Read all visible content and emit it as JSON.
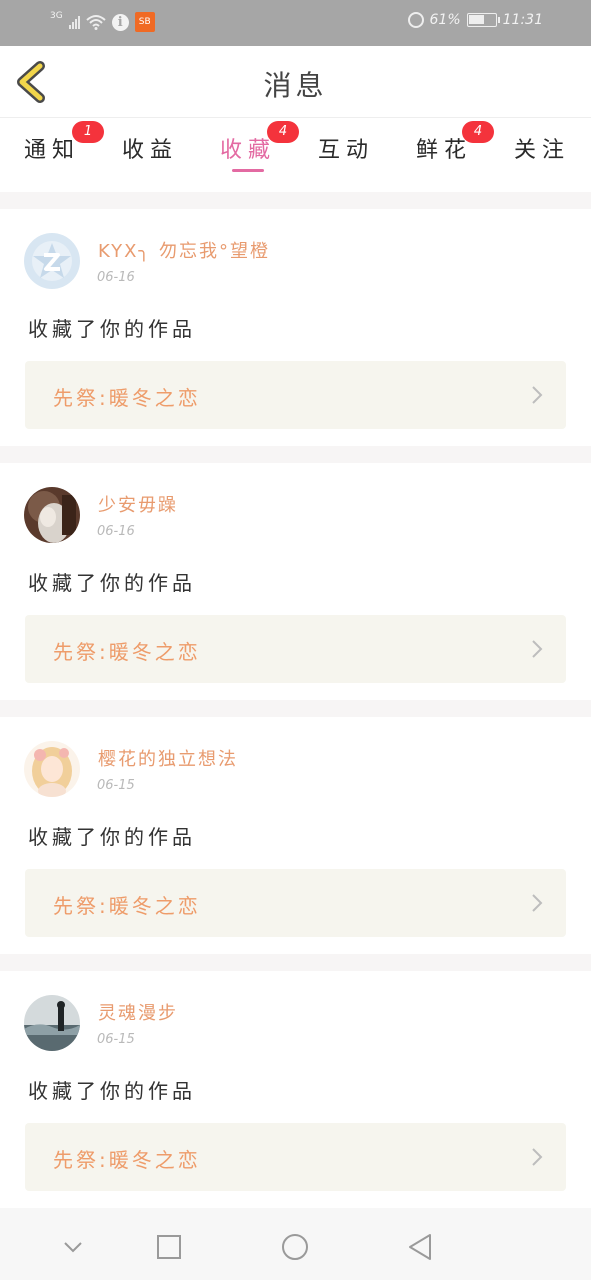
{
  "status_bar": {
    "network": "3G",
    "app_badge": "SB",
    "battery": "61%",
    "battery_level": 0.61,
    "time": "11:31"
  },
  "header": {
    "title": "消息",
    "back_icon": "chevron-left-icon"
  },
  "tabs": [
    {
      "label": "通知",
      "badge": "1",
      "active": false
    },
    {
      "label": "收益",
      "badge": "",
      "active": false
    },
    {
      "label": "收藏",
      "badge": "4",
      "active": true
    },
    {
      "label": "互动",
      "badge": "",
      "active": false
    },
    {
      "label": "鲜花",
      "badge": "4",
      "active": false
    },
    {
      "label": "关注",
      "badge": "",
      "active": false
    }
  ],
  "messages": [
    {
      "username": "KYX╮ 勿忘我°望橙",
      "date": "06-16",
      "action": "收藏了你的作品",
      "work_title": "先祭:暖冬之恋",
      "avatar": "default-qq-avatar"
    },
    {
      "username": "少安毋躁",
      "date": "06-16",
      "action": "收藏了你的作品",
      "work_title": "先祭:暖冬之恋",
      "avatar": "photo-avatar"
    },
    {
      "username": "樱花的独立想法",
      "date": "06-15",
      "action": "收藏了你的作品",
      "work_title": "先祭:暖冬之恋",
      "avatar": "anime-girl-avatar"
    },
    {
      "username": "灵魂漫步",
      "date": "06-15",
      "action": "收藏了你的作品",
      "work_title": "先祭:暖冬之恋",
      "avatar": "scenery-avatar"
    }
  ],
  "colors": {
    "accent": "#e36aa2",
    "badge": "#f4333c",
    "username": "#e89b6f",
    "work_link_bg": "#f6f5ee",
    "back_icon": "#f2d64b"
  },
  "nav_bar": [
    "chevron-down-icon",
    "square-icon",
    "circle-icon",
    "triangle-back-icon"
  ]
}
